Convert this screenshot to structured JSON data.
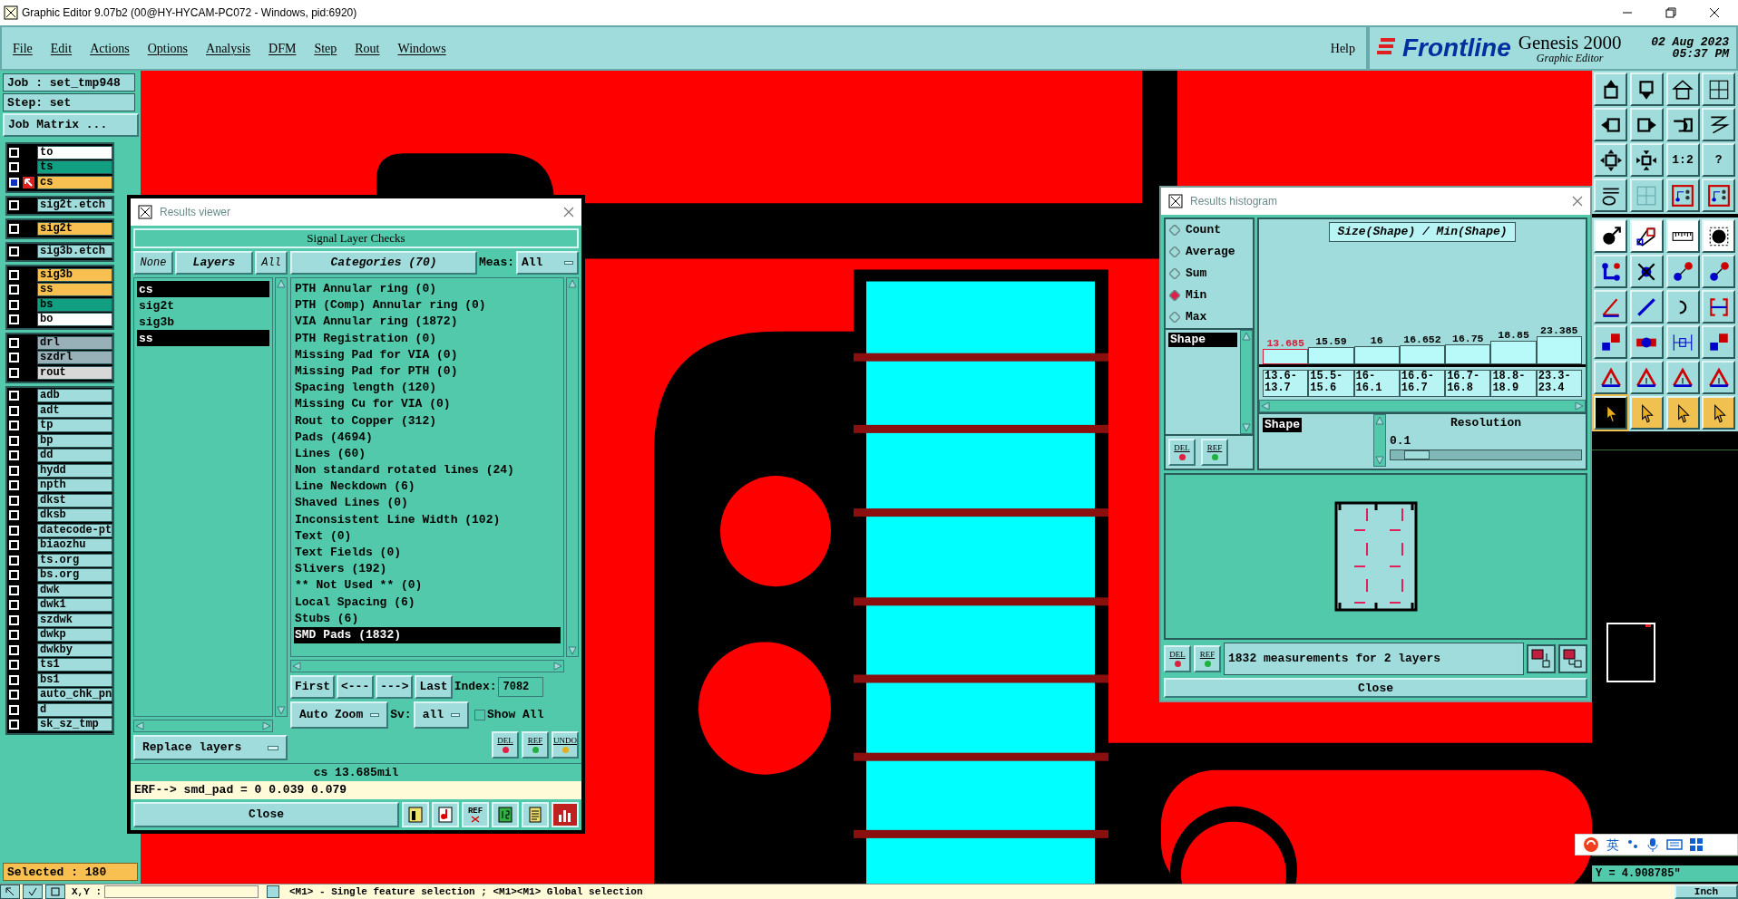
{
  "window": {
    "title": "Graphic Editor 9.07b2 (00@HY-HYCAM-PC072 - Windows, pid:6920)"
  },
  "menu": [
    "File",
    "Edit",
    "Actions",
    "Options",
    "Analysis",
    "DFM",
    "Step",
    "Rout",
    "Windows"
  ],
  "help": "Help",
  "brand": {
    "logo": "Frontline",
    "product": "Genesis 2000",
    "subtitle": "Graphic Editor",
    "date": "02 Aug 2023",
    "time": "05:37 PM"
  },
  "job": {
    "job": "Job : set_tmp948",
    "step": "Step: set",
    "matrix_button": "Job Matrix ..."
  },
  "layer_groups": [
    {
      "layers": [
        {
          "name": "to",
          "color": "#ffffff",
          "work": false
        },
        {
          "name": "ts",
          "color": "#129e80",
          "work": false
        },
        {
          "name": "cs",
          "color": "#f8c050",
          "work": true
        }
      ]
    },
    {
      "layers": [
        {
          "name": "sig2t.etch",
          "color": "#a0dcdc",
          "work": false
        }
      ]
    },
    {
      "layers": [
        {
          "name": "sig2t",
          "color": "#f8c050",
          "work": false
        }
      ]
    },
    {
      "layers": [
        {
          "name": "sig3b.etch",
          "color": "#a0dcdc",
          "work": false
        }
      ]
    },
    {
      "layers": [
        {
          "name": "sig3b",
          "color": "#f8c050",
          "work": false
        },
        {
          "name": "ss",
          "color": "#f8c050",
          "work": false
        },
        {
          "name": "bs",
          "color": "#129e80",
          "work": false
        },
        {
          "name": "bo",
          "color": "#ffffff",
          "work": false
        }
      ]
    },
    {
      "layers": [
        {
          "name": "drl",
          "color": "#98b0b8",
          "work": false
        },
        {
          "name": "szdrl",
          "color": "#98b0b8",
          "work": false
        },
        {
          "name": "rout",
          "color": "#d8d8d8",
          "work": false
        }
      ]
    },
    {
      "layers": [
        {
          "name": "adb",
          "color": "#a0dcdc",
          "work": false
        },
        {
          "name": "adt",
          "color": "#a0dcdc",
          "work": false
        },
        {
          "name": "tp",
          "color": "#a0dcdc",
          "work": false
        },
        {
          "name": "bp",
          "color": "#a0dcdc",
          "work": false
        },
        {
          "name": "dd",
          "color": "#a0dcdc",
          "work": false
        },
        {
          "name": "hydd",
          "color": "#a0dcdc",
          "work": false
        },
        {
          "name": "npth",
          "color": "#a0dcdc",
          "work": false
        },
        {
          "name": "dkst",
          "color": "#a0dcdc",
          "work": false
        },
        {
          "name": "dksb",
          "color": "#a0dcdc",
          "work": false
        },
        {
          "name": "datecode-pt",
          "color": "#a0dcdc",
          "work": false
        },
        {
          "name": "biaozhu",
          "color": "#a0dcdc",
          "work": false
        },
        {
          "name": "ts.org",
          "color": "#a0dcdc",
          "work": false
        },
        {
          "name": "bs.org",
          "color": "#a0dcdc",
          "work": false
        },
        {
          "name": "dwk",
          "color": "#a0dcdc",
          "work": false
        },
        {
          "name": "dwk1",
          "color": "#a0dcdc",
          "work": false
        },
        {
          "name": "szdwk",
          "color": "#a0dcdc",
          "work": false
        },
        {
          "name": "dwkp",
          "color": "#a0dcdc",
          "work": false
        },
        {
          "name": "dwkby",
          "color": "#a0dcdc",
          "work": false
        },
        {
          "name": "ts1",
          "color": "#a0dcdc",
          "work": false
        },
        {
          "name": "bs1",
          "color": "#a0dcdc",
          "work": false
        },
        {
          "name": "auto_chk_pn",
          "color": "#a0dcdc",
          "work": false
        },
        {
          "name": "d",
          "color": "#a0dcdc",
          "work": false
        },
        {
          "name": "sk_sz_tmp",
          "color": "#a0dcdc",
          "work": false
        }
      ]
    }
  ],
  "selected_count": "Selected : 180",
  "toolbar_glyphs": [
    "1:2",
    "?"
  ],
  "results_viewer": {
    "title": "Results viewer",
    "heading": "Signal Layer Checks",
    "none_button": "None",
    "layers_button": "Layers",
    "all_button": "All",
    "layers": [
      {
        "name": "cs",
        "selected": true
      },
      {
        "name": "sig2t",
        "selected": false
      },
      {
        "name": "sig3b",
        "selected": false
      },
      {
        "name": "ss",
        "selected": true
      }
    ],
    "categories_button": "Categories (70)",
    "meas_label": "Meas:",
    "meas_value": "All",
    "categories": [
      {
        "label": "PTH Annular ring (0)",
        "selected": false
      },
      {
        "label": "PTH (Comp) Annular ring (0)",
        "selected": false
      },
      {
        "label": "VIA Annular ring (1872)",
        "selected": false
      },
      {
        "label": "PTH Registration (0)",
        "selected": false
      },
      {
        "label": "Missing Pad for VIA (0)",
        "selected": false
      },
      {
        "label": "Missing Pad for PTH (0)",
        "selected": false
      },
      {
        "label": "Spacing length (120)",
        "selected": false
      },
      {
        "label": "Missing Cu for VIA (0)",
        "selected": false
      },
      {
        "label": "Rout to Copper (312)",
        "selected": false
      },
      {
        "label": "Pads (4694)",
        "selected": false
      },
      {
        "label": "Lines (60)",
        "selected": false
      },
      {
        "label": "Non standard rotated lines (24)",
        "selected": false
      },
      {
        "label": "Line Neckdown (6)",
        "selected": false
      },
      {
        "label": "Shaved Lines (0)",
        "selected": false
      },
      {
        "label": "Inconsistent Line Width (102)",
        "selected": false
      },
      {
        "label": "Text (0)",
        "selected": false
      },
      {
        "label": "Text Fields (0)",
        "selected": false
      },
      {
        "label": "Slivers (192)",
        "selected": false
      },
      {
        "label": "** Not Used ** (0)",
        "selected": false
      },
      {
        "label": "Local Spacing (6)",
        "selected": false
      },
      {
        "label": "Stubs (6)",
        "selected": false
      },
      {
        "label": "SMD Pads (1832)",
        "selected": true
      }
    ],
    "nav": [
      "First",
      "<---",
      "--->",
      "Last"
    ],
    "index_label": "Index:",
    "index_value": "7082",
    "auto_zoom": "Auto Zoom",
    "sv_label": "Sv:",
    "sv_value": "all",
    "show_all": {
      "label": "Show All",
      "checked": false
    },
    "replace": "Replace layers",
    "tools": [
      "DEL",
      "REF",
      "UNDO"
    ],
    "measurement": "cs 13.685mil",
    "erf": "ERF--> smd_pad = 0 0.039 0.079",
    "close": "Close",
    "bottom_glyphs": [
      "REF"
    ]
  },
  "histogram": {
    "title": "Results histogram",
    "modes": [
      {
        "label": "Count",
        "selected": false
      },
      {
        "label": "Average",
        "selected": false
      },
      {
        "label": "Sum",
        "selected": false
      },
      {
        "label": "Min",
        "selected": true
      },
      {
        "label": "Max",
        "selected": false
      }
    ],
    "items": [
      {
        "label": "Shape",
        "selected": true
      }
    ],
    "chart_title": "Size(Shape) / Min(Shape)",
    "bins": [
      {
        "range": "13.6-13.7",
        "value": "13.685",
        "selected": true
      },
      {
        "range": "15.5-15.6",
        "value": "15.59",
        "selected": false
      },
      {
        "range": "16-16.1",
        "value": "16",
        "selected": false
      },
      {
        "range": "16.6-16.7",
        "value": "16.652",
        "selected": false
      },
      {
        "range": "16.7-16.8",
        "value": "16.75",
        "selected": false
      },
      {
        "range": "18.8-18.9",
        "value": "18.85",
        "selected": false
      },
      {
        "range": "23.3-23.4",
        "value": "23.385",
        "selected": false
      }
    ],
    "shape_item": {
      "label": "Shape",
      "selected": true
    },
    "resolution_label": "Resolution",
    "resolution_value": "0.1",
    "resolution": {
      "level": 0.07
    },
    "tools_top": [
      "DEL",
      "REF"
    ],
    "tools_bottom": [
      "DEL",
      "REF"
    ],
    "summary": "1832 measurements for 2 layers",
    "close": "Close"
  },
  "status_bar": {
    "xy_label": "X,Y :",
    "hint": "<M1> - Single feature selection ; <M1><M1> Global selection",
    "coord_y": "Y = 4.908785\"",
    "units": "Inch"
  },
  "ime": {
    "label": "英"
  }
}
